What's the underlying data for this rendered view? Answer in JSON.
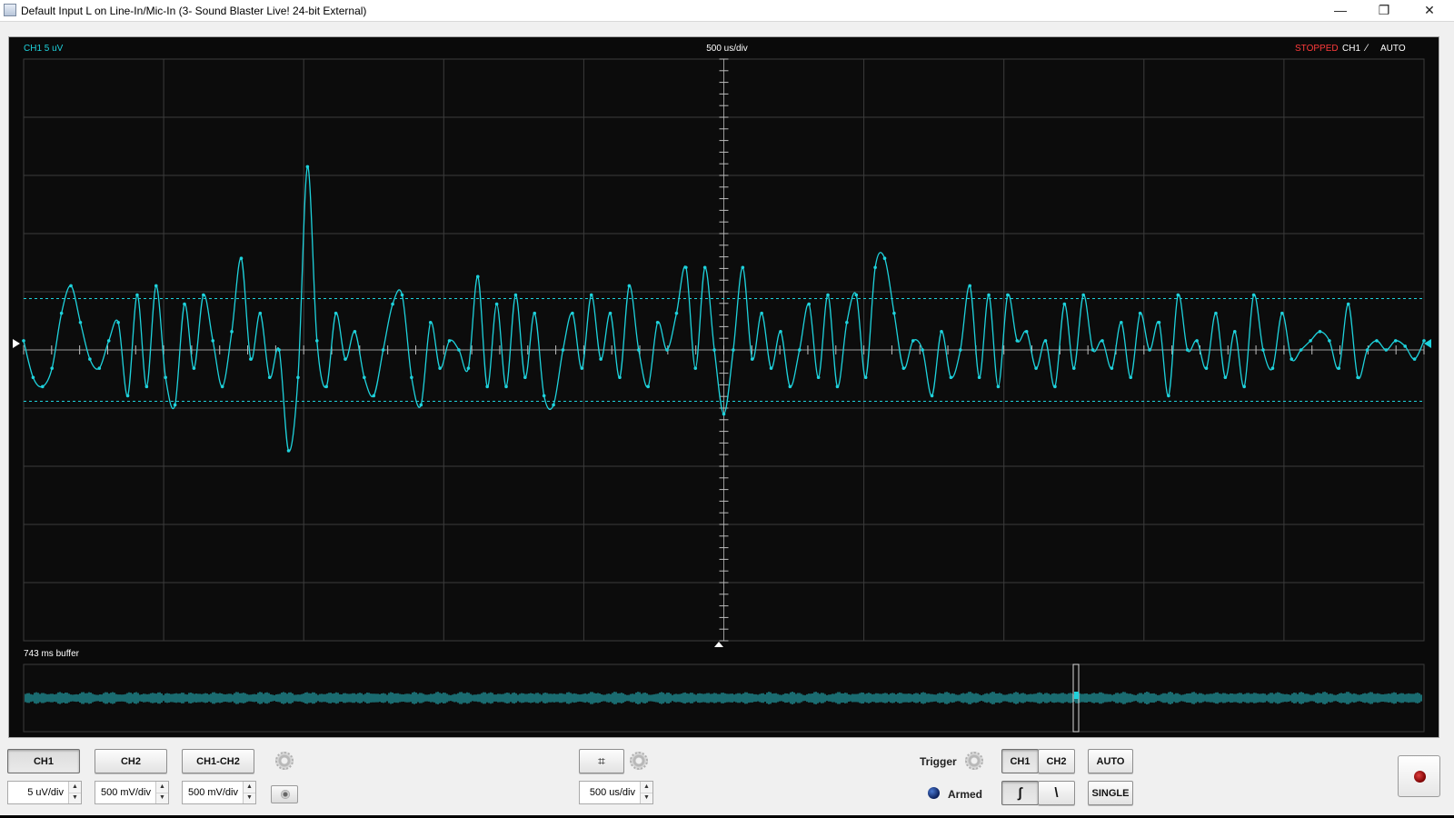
{
  "window": {
    "title": "Default Input L on Line-In/Mic-In (3- Sound Blaster Live! 24-bit External)",
    "controls": {
      "minimize": "—",
      "restore": "❐",
      "close": "✕"
    }
  },
  "scope": {
    "channel_label": "CH1 5 uV",
    "timebase_label": "500 us/div",
    "status": "STOPPED",
    "trigger_channel": "CH1",
    "trigger_slope_symbol": "⁄",
    "trigger_mode": "AUTO",
    "buffer_label": "743 ms buffer",
    "grid_divisions": {
      "horizontal": 10,
      "vertical": 10
    },
    "colors": {
      "trace": "#1ed2dc",
      "grid": "#3c3c3c",
      "background": "#0c0c0c",
      "status_stopped": "#ff3b3b",
      "buffer_trace": "#1a6b70"
    }
  },
  "controls": {
    "channel_buttons": [
      {
        "label": "CH1",
        "pressed": true
      },
      {
        "label": "CH2",
        "pressed": false
      },
      {
        "label": "CH1-CH2",
        "pressed": false
      }
    ],
    "volts_per_div": [
      "5 uV/div",
      "500 mV/div",
      "500 mV/div"
    ],
    "time_per_div": "500 us/div",
    "trigger_label": "Trigger",
    "trigger_source": [
      {
        "label": "CH1",
        "pressed": true
      },
      {
        "label": "CH2",
        "pressed": false
      }
    ],
    "trigger_mode_buttons": [
      "AUTO",
      "SINGLE"
    ],
    "armed_label": "Armed",
    "slope_buttons": [
      {
        "icon": "rising-edge-icon",
        "symbol": "∫",
        "pressed": true
      },
      {
        "icon": "falling-edge-icon",
        "symbol": "\\",
        "pressed": false
      }
    ]
  },
  "chart_data": {
    "type": "line",
    "title": "",
    "xlabel": "",
    "ylabel": "",
    "series": [
      {
        "values": [
          0.05,
          -0.15,
          -0.2,
          -0.1,
          0.2,
          0.35,
          0.15,
          -0.05,
          -0.1,
          0.05,
          0.15,
          -0.25,
          0.3,
          -0.2,
          0.35,
          -0.15,
          -0.3,
          0.25,
          -0.1,
          0.3,
          0.05,
          -0.2,
          0.1,
          0.5,
          -0.05,
          0.2,
          -0.15,
          0.0,
          -0.55,
          -0.15,
          1.0,
          0.05,
          -0.2,
          0.2,
          -0.05,
          0.1,
          -0.15,
          -0.25,
          0.0,
          0.25,
          0.3,
          -0.15,
          -0.3,
          0.15,
          -0.1,
          0.05,
          0.0,
          -0.1,
          0.4,
          -0.2,
          0.25,
          -0.2,
          0.3,
          -0.15,
          0.2,
          -0.25,
          -0.3,
          0.0,
          0.2,
          -0.1,
          0.3,
          -0.05,
          0.2,
          -0.15,
          0.35,
          0.0,
          -0.2,
          0.15,
          0.0,
          0.2,
          0.45,
          -0.1,
          0.45,
          0.0,
          -0.35,
          0.0,
          0.45,
          -0.05,
          0.2,
          -0.1,
          0.1,
          -0.2,
          0.0,
          0.25,
          -0.15,
          0.3,
          -0.2,
          0.15,
          0.3,
          -0.15,
          0.45,
          0.5,
          0.2,
          -0.1,
          0.05,
          0.0,
          -0.25,
          0.1,
          -0.15,
          0.0,
          0.35,
          -0.15,
          0.3,
          -0.2,
          0.3,
          0.05,
          0.1,
          -0.1,
          0.05,
          -0.2,
          0.25,
          -0.1,
          0.3,
          0.0,
          0.05,
          -0.1,
          0.15,
          -0.15,
          0.2,
          0.0,
          0.15,
          -0.25,
          0.3,
          0.0,
          0.05,
          -0.1,
          0.2,
          -0.15,
          0.1,
          -0.2,
          0.3,
          0.0,
          -0.1,
          0.2,
          -0.05,
          0.0,
          0.05,
          0.1,
          0.05,
          -0.1,
          0.25,
          -0.15,
          0.0,
          0.05,
          0.0,
          0.05,
          0.02,
          -0.05,
          0.05
        ]
      }
    ],
    "ylim": [
      -1,
      1
    ],
    "trigger_level_band": [
      0.28,
      -0.28
    ],
    "grid": true
  }
}
